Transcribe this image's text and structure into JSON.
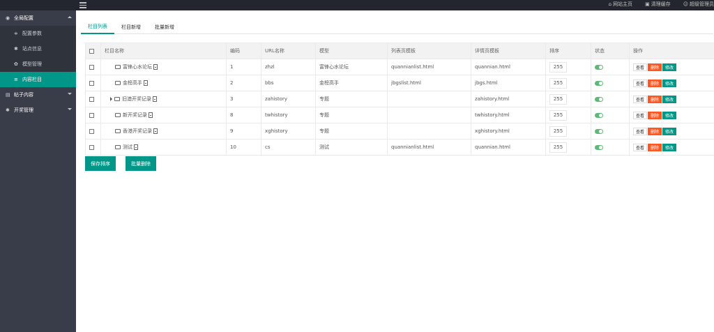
{
  "topbar": {
    "links": [
      {
        "icon": "home-icon",
        "label": "网站主页"
      },
      {
        "icon": "broom-icon",
        "label": "清理缓存"
      },
      {
        "icon": "user-icon",
        "label": "超级管理员"
      }
    ]
  },
  "sidebar": {
    "groups": [
      {
        "icon": "globe-icon",
        "label": "全局配置",
        "expanded": true
      },
      {
        "icon": "file-icon",
        "label": "帖子内容",
        "expanded": false
      },
      {
        "icon": "gear-icon",
        "label": "开奖管理",
        "expanded": false
      }
    ],
    "children": [
      {
        "icon": "sliders-icon",
        "label": "配置参数",
        "active": false
      },
      {
        "icon": "settings-icon",
        "label": "站点信息",
        "active": false
      },
      {
        "icon": "cube-icon",
        "label": "模型管理",
        "active": false
      },
      {
        "icon": "list-icon",
        "label": "内容栏目",
        "active": true
      }
    ]
  },
  "tabs": [
    {
      "label": "栏目列表",
      "active": true
    },
    {
      "label": "栏目新增",
      "active": false
    },
    {
      "label": "批量新增",
      "active": false
    }
  ],
  "table": {
    "headers": [
      "",
      "栏目名称",
      "编码",
      "URL名称",
      "模型",
      "列表页模板",
      "详情页模板",
      "排序",
      "状态",
      "操作"
    ],
    "rows": [
      {
        "name": "富锋心水论坛",
        "has_children": false,
        "code": "1",
        "url": "zhzl",
        "model": "富锋心水论坛",
        "list_tpl": "quannianlist.html",
        "detail_tpl": "quannian.html",
        "sort": "255"
      },
      {
        "name": "金榜高手",
        "has_children": false,
        "code": "2",
        "url": "bbs",
        "model": "金榜高手",
        "list_tpl": "jbgslist.html",
        "detail_tpl": "jbgs.html",
        "sort": "255"
      },
      {
        "name": "旧澳开奖记录",
        "has_children": true,
        "code": "3",
        "url": "zahistory",
        "model": "专题",
        "list_tpl": "",
        "detail_tpl": "zahistory.html",
        "sort": "255"
      },
      {
        "name": "新开奖记录",
        "has_children": false,
        "code": "8",
        "url": "twhistory",
        "model": "专题",
        "list_tpl": "",
        "detail_tpl": "twhistory.html",
        "sort": "255"
      },
      {
        "name": "香港开奖记录",
        "has_children": false,
        "code": "9",
        "url": "xghistory",
        "model": "专题",
        "list_tpl": "",
        "detail_tpl": "xghistory.html",
        "sort": "255"
      },
      {
        "name": "测试",
        "has_children": false,
        "code": "10",
        "url": "cs",
        "model": "测试",
        "list_tpl": "quannianlist.html",
        "detail_tpl": "quannian.html",
        "sort": "255"
      }
    ],
    "actions": {
      "view": "查看",
      "delete": "删除",
      "edit": "修改"
    }
  },
  "buttons": {
    "save_sort": "保存排序",
    "batch_delete": "批量删除"
  },
  "colors": {
    "accent": "#009688",
    "danger": "#ff5722",
    "switch_on": "#5fb878",
    "topbar": "#23262e",
    "sidebar": "#393d49"
  }
}
